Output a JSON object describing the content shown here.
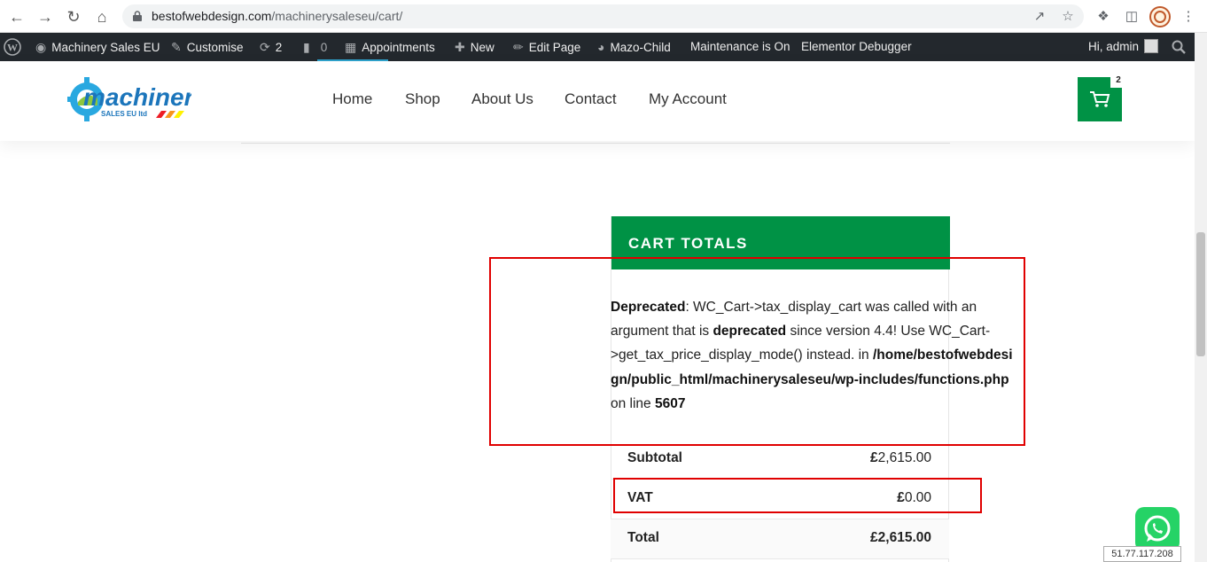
{
  "browser": {
    "url_domain": "bestofwebdesign.com",
    "url_path": "/machinerysaleseu/cart/"
  },
  "adminbar": {
    "site_name": "Machinery Sales EU",
    "customise": "Customise",
    "updates_count": "2",
    "comments_count": "0",
    "appointments": "Appointments",
    "new": "New",
    "edit_page": "Edit Page",
    "theme": "Mazo-Child",
    "maintenance": "Maintenance is On",
    "debugger": "Elementor Debugger",
    "greeting": "Hi, admin"
  },
  "header": {
    "logo_text": "machinery",
    "logo_subtext": "SALES EU ltd",
    "menu": [
      "Home",
      "Shop",
      "About Us",
      "Contact",
      "My Account"
    ],
    "cart_count": "2"
  },
  "cart_totals": {
    "title": "CART TOTALS",
    "notice": {
      "label": "Deprecated",
      "part1": ": WC_Cart->tax_display_cart was called with an argument that is ",
      "emph": "deprecated",
      "part2": " since version 4.4! Use WC_Cart->get_tax_price_display_mode() instead. in ",
      "path": "/home/bestofwebdesign/public_html/machinerysaleseu/wp-includes/functions.php",
      "part3": " on line ",
      "line": "5607"
    },
    "rows": [
      {
        "label": "Subtotal",
        "currency": "£",
        "amount": "2,615.00"
      },
      {
        "label": "VAT",
        "currency": "£",
        "amount": "0.00"
      },
      {
        "label": "Total",
        "currency": "£",
        "amount": "2,615.00"
      }
    ]
  },
  "ip_badge": "51.77.117.208",
  "colors": {
    "brand_green": "#009245",
    "admin_bar": "#23282d",
    "highlight_red": "#e00000",
    "whatsapp": "#25d366"
  }
}
